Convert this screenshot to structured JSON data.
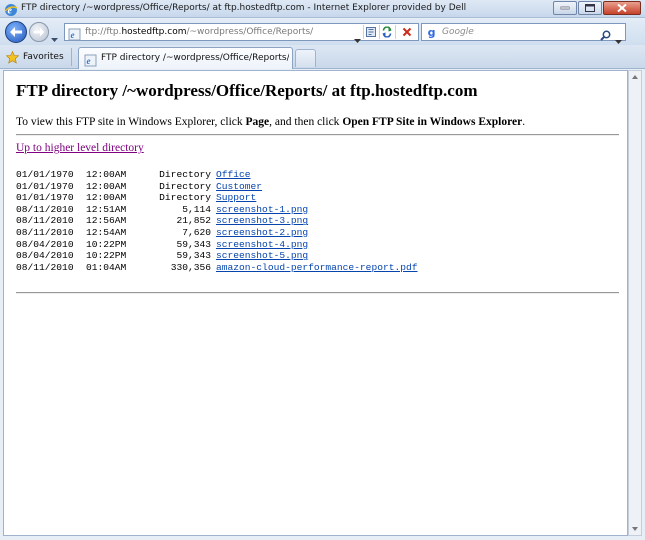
{
  "window": {
    "title": "FTP directory /~wordpress/Office/Reports/ at ftp.hostedftp.com - Internet Explorer provided by Dell"
  },
  "nav": {
    "address_prefix": "ftp://ftp.",
    "address_host": "hostedftp.com",
    "address_path": "/~wordpress/Office/Reports/",
    "search_placeholder": "Google"
  },
  "toolbar": {
    "favorites_label": "Favorites",
    "tab_label": "FTP directory /~wordpress/Office/Reports/ at ftp..."
  },
  "page": {
    "heading": "FTP directory /~wordpress/Office/Reports/ at ftp.hostedftp.com",
    "intro_prefix": "To view this FTP site in Windows Explorer, click ",
    "intro_page": "Page",
    "intro_middle": ", and then click ",
    "intro_open": "Open FTP Site in Windows Explorer",
    "intro_suffix": ".",
    "up_link": "Up to higher level directory"
  },
  "listing": [
    {
      "date": "01/01/1970",
      "time": "12:00AM",
      "size": "Directory",
      "name": "Office"
    },
    {
      "date": "01/01/1970",
      "time": "12:00AM",
      "size": "Directory",
      "name": "Customer"
    },
    {
      "date": "01/01/1970",
      "time": "12:00AM",
      "size": "Directory",
      "name": "Support"
    },
    {
      "date": "08/11/2010",
      "time": "12:51AM",
      "size": "5,114",
      "name": "screenshot-1.png"
    },
    {
      "date": "08/11/2010",
      "time": "12:56AM",
      "size": "21,852",
      "name": "screenshot-3.png"
    },
    {
      "date": "08/11/2010",
      "time": "12:54AM",
      "size": "7,620",
      "name": "screenshot-2.png"
    },
    {
      "date": "08/04/2010",
      "time": "10:22PM",
      "size": "59,343",
      "name": "screenshot-4.png"
    },
    {
      "date": "08/04/2010",
      "time": "10:22PM",
      "size": "59,343",
      "name": "screenshot-5.png"
    },
    {
      "date": "08/11/2010",
      "time": "01:04AM",
      "size": "330,356",
      "name": "amazon-cloud-performance-report.pdf"
    }
  ]
}
